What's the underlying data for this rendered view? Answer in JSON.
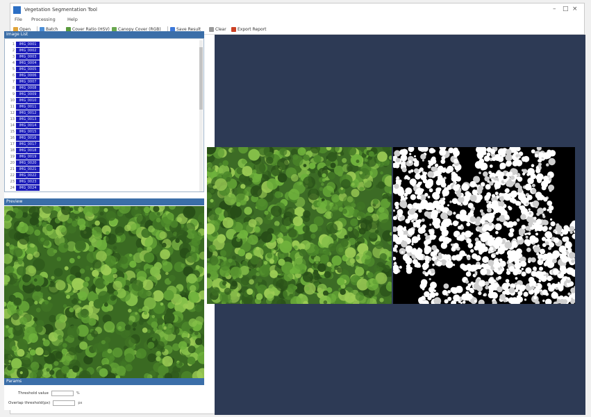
{
  "window": {
    "title": "Vegetation Segmentation Tool",
    "controls": [
      "–",
      "□",
      "×"
    ]
  },
  "menu": {
    "items": [
      "File",
      "Processing",
      "Help"
    ]
  },
  "toolbar": {
    "items": [
      {
        "label": "Open",
        "icon": "folder-icon",
        "color": "#e0a43a"
      },
      {
        "label": "Batch",
        "icon": "layers-icon",
        "color": "#4b8ed6"
      },
      {
        "label": "Cover Ratio (HSV)",
        "icon": "grid-icon",
        "color": "#5a9a3c"
      },
      {
        "label": "Canopy Cover (RGB)",
        "icon": "leaf-icon",
        "color": "#6aa84f"
      },
      {
        "label": "Save Result",
        "icon": "save-icon",
        "color": "#3c78d8"
      },
      {
        "label": "Clear",
        "icon": "clear-icon",
        "color": "#999999"
      },
      {
        "label": "Export Report",
        "icon": "report-icon",
        "color": "#cc4125"
      }
    ]
  },
  "file_list": {
    "header": "Image List",
    "rows": [
      {
        "num": "1",
        "name": "IMG_0001"
      },
      {
        "num": "2",
        "name": "IMG_0002"
      },
      {
        "num": "3",
        "name": "IMG_0003"
      },
      {
        "num": "4",
        "name": "IMG_0004"
      },
      {
        "num": "5",
        "name": "IMG_0005"
      },
      {
        "num": "6",
        "name": "IMG_0006"
      },
      {
        "num": "7",
        "name": "IMG_0007"
      },
      {
        "num": "8",
        "name": "IMG_0008"
      },
      {
        "num": "9",
        "name": "IMG_0009"
      },
      {
        "num": "10",
        "name": "IMG_0010"
      },
      {
        "num": "11",
        "name": "IMG_0011"
      },
      {
        "num": "12",
        "name": "IMG_0012"
      },
      {
        "num": "13",
        "name": "IMG_0013"
      },
      {
        "num": "14",
        "name": "IMG_0014"
      },
      {
        "num": "15",
        "name": "IMG_0015"
      },
      {
        "num": "16",
        "name": "IMG_0016"
      },
      {
        "num": "17",
        "name": "IMG_0017"
      },
      {
        "num": "18",
        "name": "IMG_0018"
      },
      {
        "num": "19",
        "name": "IMG_0019"
      },
      {
        "num": "20",
        "name": "IMG_0020"
      },
      {
        "num": "21",
        "name": "IMG_0021"
      },
      {
        "num": "22",
        "name": "IMG_0022"
      },
      {
        "num": "23",
        "name": "IMG_0023"
      },
      {
        "num": "24",
        "name": "IMG_0024"
      }
    ]
  },
  "preview": {
    "header": "Preview"
  },
  "params": {
    "header": "Params",
    "fields": [
      {
        "label": "Threshold value",
        "value": "",
        "unit": "%"
      },
      {
        "label": "Overlap threshold(px)",
        "value": "",
        "unit": "px"
      }
    ]
  },
  "colors": {
    "panel_header": "#3b6ea8",
    "workspace_bg": "#2d3a55",
    "list_cell": "#1a1ab8"
  }
}
